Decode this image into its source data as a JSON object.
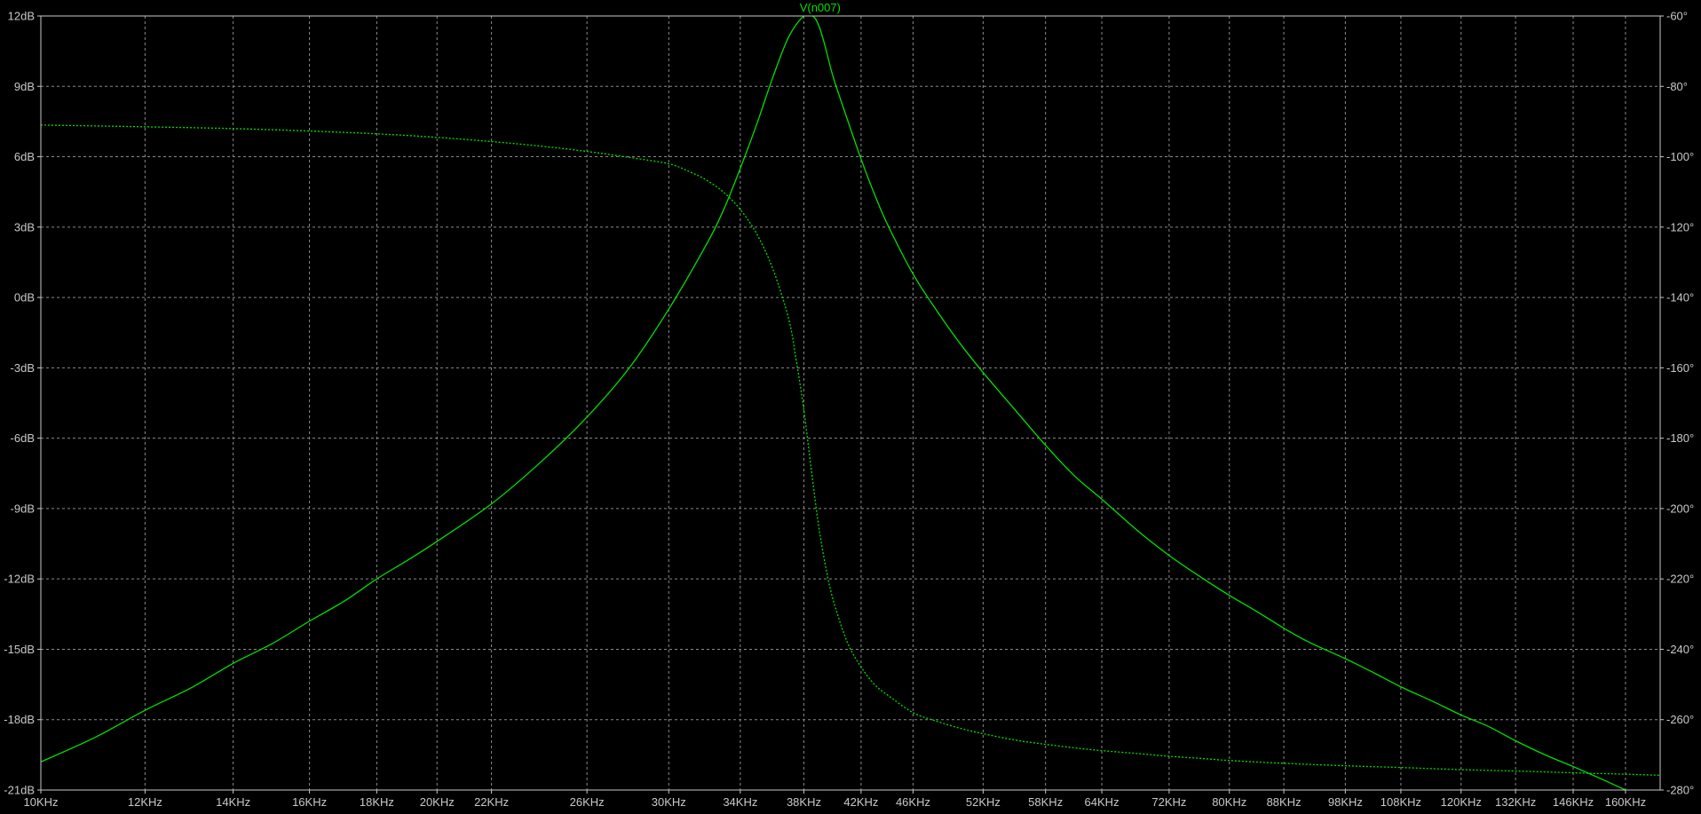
{
  "chart_data": {
    "type": "line",
    "title": "V(n007)",
    "xscale": "log",
    "xlim": [
      10,
      170
    ],
    "x_unit": "KHz",
    "ylim_left": [
      -21,
      12
    ],
    "ylim_right": [
      -280,
      -60
    ],
    "grid": true,
    "colors": {
      "background": "#000000",
      "grid": "#8a8a8a",
      "frame": "#c8c8c8",
      "tick_label": "#c8c8c8",
      "trace": "#00e000"
    },
    "x_ticks": [
      "10KHz",
      "12KHz",
      "14KHz",
      "16KHz",
      "18KHz",
      "20KHz",
      "22KHz",
      "26KHz",
      "30KHz",
      "34KHz",
      "38KHz",
      "42KHz",
      "46KHz",
      "52KHz",
      "58KHz",
      "64KHz",
      "72KHz",
      "80KHz",
      "88KHz",
      "98KHz",
      "108KHz",
      "120KHz",
      "132KHz",
      "146KHz",
      "160KHz"
    ],
    "x_tick_values": [
      10,
      12,
      14,
      16,
      18,
      20,
      22,
      26,
      30,
      34,
      38,
      42,
      46,
      52,
      58,
      64,
      72,
      80,
      88,
      98,
      108,
      120,
      132,
      146,
      160
    ],
    "y_left_ticks": [
      "12dB",
      "9dB",
      "6dB",
      "3dB",
      "0dB",
      "-3dB",
      "-6dB",
      "-9dB",
      "-12dB",
      "-15dB",
      "-18dB",
      "-21dB"
    ],
    "y_left_tick_values": [
      12,
      9,
      6,
      3,
      0,
      -3,
      -6,
      -9,
      -12,
      -15,
      -18,
      -21
    ],
    "y_right_ticks": [
      "-60°",
      "-80°",
      "-100°",
      "-120°",
      "-140°",
      "-160°",
      "-180°",
      "-200°",
      "-220°",
      "-240°",
      "-260°",
      "-280°"
    ],
    "y_right_tick_values": [
      -60,
      -80,
      -100,
      -120,
      -140,
      -160,
      -180,
      -200,
      -220,
      -240,
      -260,
      -280
    ],
    "series": [
      {
        "style": "solid",
        "axis": "left",
        "unit": "dB",
        "x": [
          10,
          11,
          12,
          13,
          14,
          15,
          16,
          17,
          18,
          19,
          20,
          22,
          24,
          26,
          28,
          30,
          32,
          33,
          34,
          35,
          36,
          37,
          38,
          38.6,
          39,
          39.4,
          40,
          41,
          42,
          43,
          44,
          46,
          48,
          50,
          52,
          55,
          58,
          61,
          64,
          68,
          72,
          76,
          80,
          84,
          88,
          92,
          98,
          103,
          108,
          114,
          120,
          126,
          132,
          139,
          146,
          153,
          160,
          170
        ],
        "y": [
          -19.8,
          -18.75,
          -17.6,
          -16.65,
          -15.6,
          -14.75,
          -13.8,
          -12.95,
          -12.0,
          -11.2,
          -10.4,
          -8.8,
          -7.0,
          -5.1,
          -3.0,
          -0.5,
          2.2,
          3.7,
          5.5,
          7.4,
          9.4,
          11.1,
          12.0,
          12.0,
          11.6,
          10.8,
          9.4,
          7.6,
          5.9,
          4.4,
          3.1,
          1.0,
          -0.6,
          -2.0,
          -3.2,
          -4.8,
          -6.3,
          -7.6,
          -8.6,
          -9.9,
          -11.0,
          -11.9,
          -12.7,
          -13.4,
          -14.1,
          -14.7,
          -15.4,
          -16.0,
          -16.6,
          -17.2,
          -17.8,
          -18.3,
          -18.9,
          -19.5,
          -20.0,
          -20.5,
          -21.0,
          -21.7
        ]
      },
      {
        "style": "dotted",
        "axis": "right",
        "unit": "°",
        "x": [
          10,
          12,
          14,
          16,
          18,
          20,
          22,
          24,
          26,
          28,
          30,
          31,
          32,
          33,
          34,
          35,
          36,
          37,
          37.5,
          38,
          38.5,
          39,
          39.5,
          40,
          41,
          42,
          43,
          44,
          46,
          48,
          50,
          52,
          55,
          58,
          61,
          64,
          68,
          72,
          76,
          80,
          88,
          98,
          108,
          120,
          132,
          146,
          160,
          170
        ],
        "y": [
          -91.0,
          -91.5,
          -92.0,
          -92.7,
          -93.5,
          -94.5,
          -95.7,
          -97.0,
          -98.5,
          -100.2,
          -102.0,
          -104.0,
          -106.5,
          -110.0,
          -115.0,
          -122.0,
          -132.0,
          -146.0,
          -158.0,
          -172.0,
          -189.0,
          -205.0,
          -217.0,
          -226.0,
          -238.0,
          -245.0,
          -250.0,
          -253.0,
          -258.0,
          -260.5,
          -262.5,
          -264.0,
          -265.8,
          -267.0,
          -268.0,
          -268.8,
          -269.6,
          -270.4,
          -271.0,
          -271.6,
          -272.4,
          -273.1,
          -273.6,
          -274.2,
          -274.6,
          -275.1,
          -275.5,
          -275.8
        ]
      }
    ]
  }
}
